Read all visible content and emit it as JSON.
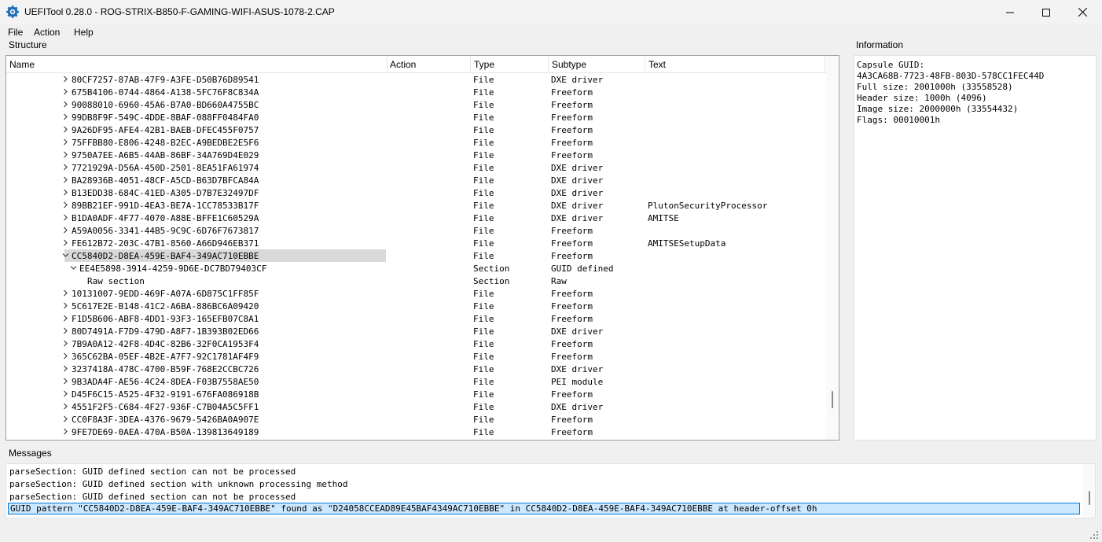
{
  "window": {
    "title": "UEFITool 0.28.0 - ROG-STRIX-B850-F-GAMING-WIFI-ASUS-1078-2.CAP"
  },
  "menu": [
    "File",
    "Action",
    "Help"
  ],
  "structure": {
    "label": "Structure",
    "columns": [
      "Name",
      "Action",
      "Type",
      "Subtype",
      "Text"
    ],
    "rows": [
      {
        "name": "80CF7257-87AB-47F9-A3FE-D50B76D89541",
        "type": "File",
        "subtype": "DXE driver",
        "text": "",
        "indent": 1,
        "chevron": "right"
      },
      {
        "name": "675B4106-0744-4864-A138-5FC76F8C834A",
        "type": "File",
        "subtype": "Freeform",
        "text": "",
        "indent": 1,
        "chevron": "right"
      },
      {
        "name": "90088010-6960-45A6-B7A0-BD660A4755BC",
        "type": "File",
        "subtype": "Freeform",
        "text": "",
        "indent": 1,
        "chevron": "right"
      },
      {
        "name": "99DB8F9F-549C-4DDE-8BAF-088FF0484FA0",
        "type": "File",
        "subtype": "Freeform",
        "text": "",
        "indent": 1,
        "chevron": "right"
      },
      {
        "name": "9A26DF95-AFE4-42B1-BAEB-DFEC455F0757",
        "type": "File",
        "subtype": "Freeform",
        "text": "",
        "indent": 1,
        "chevron": "right"
      },
      {
        "name": "75FFBB80-E806-4248-B2EC-A9BEDBE2E5F6",
        "type": "File",
        "subtype": "Freeform",
        "text": "",
        "indent": 1,
        "chevron": "right"
      },
      {
        "name": "9750A7EE-A6B5-44AB-86BF-34A769D4E029",
        "type": "File",
        "subtype": "Freeform",
        "text": "",
        "indent": 1,
        "chevron": "right"
      },
      {
        "name": "7721929A-D56A-450D-2501-8EA51FA61974",
        "type": "File",
        "subtype": "DXE driver",
        "text": "",
        "indent": 1,
        "chevron": "right"
      },
      {
        "name": "BA28936B-4051-48CF-A5CD-B63D7BFCA84A",
        "type": "File",
        "subtype": "DXE driver",
        "text": "",
        "indent": 1,
        "chevron": "right"
      },
      {
        "name": "B13EDD38-684C-41ED-A305-D7B7E32497DF",
        "type": "File",
        "subtype": "DXE driver",
        "text": "",
        "indent": 1,
        "chevron": "right"
      },
      {
        "name": "89BB21EF-991D-4EA3-BE7A-1CC78533B17F",
        "type": "File",
        "subtype": "DXE driver",
        "text": "PlutonSecurityProcessor",
        "indent": 1,
        "chevron": "right"
      },
      {
        "name": "B1DA0ADF-4F77-4070-A88E-BFFE1C60529A",
        "type": "File",
        "subtype": "DXE driver",
        "text": "AMITSE",
        "indent": 1,
        "chevron": "right"
      },
      {
        "name": "A59A0056-3341-44B5-9C9C-6D76F7673817",
        "type": "File",
        "subtype": "Freeform",
        "text": "",
        "indent": 1,
        "chevron": "right"
      },
      {
        "name": "FE612B72-203C-47B1-8560-A66D946EB371",
        "type": "File",
        "subtype": "Freeform",
        "text": "AMITSESetupData",
        "indent": 1,
        "chevron": "right"
      },
      {
        "name": "CC5840D2-D8EA-459E-BAF4-349AC710EBBE",
        "type": "File",
        "subtype": "Freeform",
        "text": "",
        "indent": 1,
        "chevron": "down",
        "selected": true
      },
      {
        "name": "EE4E5898-3914-4259-9D6E-DC7BD79403CF",
        "type": "Section",
        "subtype": "GUID defined",
        "text": "",
        "indent": 2,
        "chevron": "down"
      },
      {
        "name": "Raw section",
        "type": "Section",
        "subtype": "Raw",
        "text": "",
        "indent": 3,
        "chevron": "none"
      },
      {
        "name": "10131007-9EDD-469F-A07A-6D875C1FF85F",
        "type": "File",
        "subtype": "Freeform",
        "text": "",
        "indent": 1,
        "chevron": "right"
      },
      {
        "name": "5C617E2E-B148-41C2-A6BA-886BC6A09420",
        "type": "File",
        "subtype": "Freeform",
        "text": "",
        "indent": 1,
        "chevron": "right"
      },
      {
        "name": "F1D5B606-ABF8-4DD1-93F3-165EFB07C8A1",
        "type": "File",
        "subtype": "Freeform",
        "text": "",
        "indent": 1,
        "chevron": "right"
      },
      {
        "name": "80D7491A-F7D9-479D-A8F7-1B393B02ED66",
        "type": "File",
        "subtype": "DXE driver",
        "text": "",
        "indent": 1,
        "chevron": "right"
      },
      {
        "name": "7B9A0A12-42F8-4D4C-82B6-32F0CA1953F4",
        "type": "File",
        "subtype": "Freeform",
        "text": "",
        "indent": 1,
        "chevron": "right"
      },
      {
        "name": "365C62BA-05EF-4B2E-A7F7-92C1781AF4F9",
        "type": "File",
        "subtype": "Freeform",
        "text": "",
        "indent": 1,
        "chevron": "right"
      },
      {
        "name": "3237418A-478C-4700-B59F-768E2CCBC726",
        "type": "File",
        "subtype": "DXE driver",
        "text": "",
        "indent": 1,
        "chevron": "right"
      },
      {
        "name": "9B3ADA4F-AE56-4C24-8DEA-F03B7558AE50",
        "type": "File",
        "subtype": "PEI module",
        "text": "",
        "indent": 1,
        "chevron": "right"
      },
      {
        "name": "D45F6C15-A525-4F32-9191-676FA086918B",
        "type": "File",
        "subtype": "Freeform",
        "text": "",
        "indent": 1,
        "chevron": "right"
      },
      {
        "name": "4551F2F5-C684-4F27-936F-C7B04A5C5FF1",
        "type": "File",
        "subtype": "DXE driver",
        "text": "",
        "indent": 1,
        "chevron": "right"
      },
      {
        "name": "CC0F8A3F-3DEA-4376-9679-5426BA0A907E",
        "type": "File",
        "subtype": "Freeform",
        "text": "",
        "indent": 1,
        "chevron": "right"
      },
      {
        "name": "9FE7DE69-0AEA-470A-B50A-139813649189",
        "type": "File",
        "subtype": "Freeform",
        "text": "",
        "indent": 1,
        "chevron": "right"
      }
    ]
  },
  "information": {
    "label": "Information",
    "lines": [
      "Capsule GUID:",
      "4A3CA68B-7723-48FB-803D-578CC1FEC44D",
      "Full size: 2001000h (33558528)",
      "Header size: 1000h (4096)",
      "Image size: 2000000h (33554432)",
      "Flags: 00010001h"
    ]
  },
  "messages": {
    "label": "Messages",
    "lines": [
      "parseSection: GUID defined section can not be processed",
      "parseSection: GUID defined section with unknown processing method",
      "parseSection: GUID defined section can not be processed",
      "GUID pattern \"CC5840D2-D8EA-459E-BAF4-349AC710EBBE\" found as \"D24058CCEAD89E45BAF4349AC710EBBE\" in CC5840D2-D8EA-459E-BAF4-349AC710EBBE at header-offset 0h"
    ]
  },
  "colors": {
    "selection_row": "#d9d9d9",
    "message_highlight": "#cce8ff",
    "message_highlight_border": "#0078d7",
    "icon_accent": "#1e6fb8"
  },
  "icons": {
    "app": "uefitool-gear-icon",
    "minimize": "minimize-icon",
    "maximize": "maximize-icon",
    "close": "close-icon",
    "expand": "chevron-right-icon",
    "collapse": "chevron-down-icon"
  }
}
